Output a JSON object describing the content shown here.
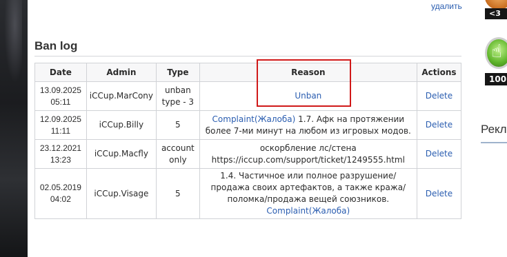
{
  "top": {
    "delete_label": "удалить"
  },
  "section": {
    "title": "Ban log"
  },
  "table": {
    "headers": {
      "date": "Date",
      "admin": "Admin",
      "type": "Type",
      "reason": "Reason",
      "actions": "Actions"
    },
    "rows": [
      {
        "date_line1": "13.09.2025",
        "date_line2": "05:11",
        "admin": "iCCup.MarCony",
        "type_line1": "unban",
        "type_line2": "type - 3",
        "reason_link": "Unban",
        "reason_text": "",
        "reason_text_before": "",
        "reason_link_after": "",
        "action": "Delete"
      },
      {
        "date_line1": "12.09.2025",
        "date_line2": "11:11",
        "admin": "iCCup.Billy",
        "type_line1": "5",
        "type_line2": "",
        "reason_link": "Complaint(Жалоба)",
        "reason_text": " 1.7. Афк на протяжении более 7-ми минут на любом из игровых модов.",
        "action": "Delete"
      },
      {
        "date_line1": "23.12.2021",
        "date_line2": "13:23",
        "admin": "iCCup.Macfly",
        "type_line1": "account",
        "type_line2": "only",
        "reason_line1": "оскорбление лс/стена",
        "reason_line2": "https://iccup.com/support/ticket/1249555.html",
        "action": "Delete"
      },
      {
        "date_line1": "02.05.2019",
        "date_line2": "04:02",
        "admin": "iCCup.Visage",
        "type_line1": "5",
        "type_line2": "",
        "reason_text_before": "1.4. Частичное или полное разрушение/продажа своих артефактов, а также кража/поломка/продажа вещей союзников. ",
        "reason_link": "Complaint(Жалоба)",
        "action": "Delete"
      }
    ]
  },
  "sidebar": {
    "badge_top_label": "<3",
    "badge_mid_label": "100",
    "heading": "Рекл"
  },
  "colors": {
    "link": "#2a5db0",
    "highlight": "#d01818",
    "border": "#d0d2d6"
  },
  "icons": {
    "badge_top": "heart-badge-icon",
    "badge_mid": "thumbs-up-badge-icon"
  }
}
